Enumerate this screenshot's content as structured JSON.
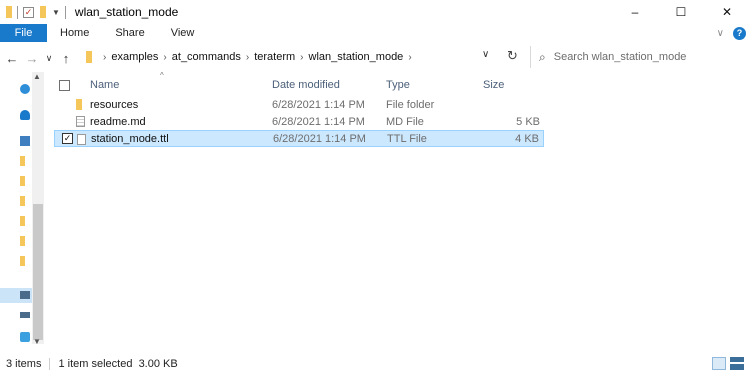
{
  "window": {
    "title": "wlan_station_mode",
    "controls": {
      "minimize": "–",
      "maximize": "☐",
      "close": "✕"
    }
  },
  "ribbon": {
    "tabs": [
      {
        "label": "File"
      },
      {
        "label": "Home"
      },
      {
        "label": "Share"
      },
      {
        "label": "View"
      }
    ],
    "help_label": "?"
  },
  "address": {
    "breadcrumbs": [
      "examples",
      "at_commands",
      "teraterm",
      "wlan_station_mode"
    ],
    "search_placeholder": "Search wlan_station_mode"
  },
  "table": {
    "headers": {
      "name": "Name",
      "date": "Date modified",
      "type": "Type",
      "size": "Size"
    },
    "rows": [
      {
        "name": "resources",
        "date": "6/28/2021 1:14 PM",
        "type": "File folder",
        "size": "",
        "icon": "folder-icon",
        "selected": false
      },
      {
        "name": "readme.md",
        "date": "6/28/2021 1:14 PM",
        "type": "MD File",
        "size": "5 KB",
        "icon": "document-icon",
        "selected": false
      },
      {
        "name": "station_mode.ttl",
        "date": "6/28/2021 1:14 PM",
        "type": "TTL File",
        "size": "4 KB",
        "icon": "file-icon",
        "selected": true
      }
    ]
  },
  "status": {
    "item_count": "3 items",
    "selection": "1 item selected  3.00 KB"
  },
  "colors": {
    "accent": "#1979ca",
    "selection_bg": "#cce8ff",
    "selection_border": "#99d1ff",
    "folder": "#f5c75a"
  }
}
